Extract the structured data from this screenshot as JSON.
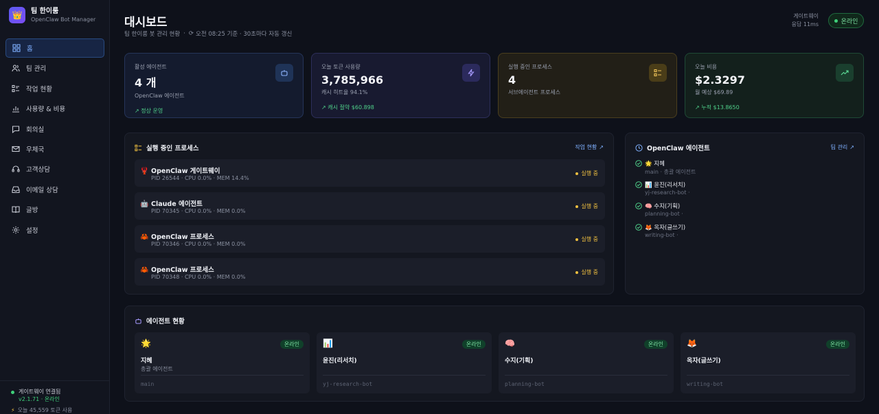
{
  "brand": {
    "name": "팀 한이룸",
    "subtitle": "OpenClaw Bot Manager",
    "logo_icon": "crown-icon"
  },
  "nav": [
    {
      "label": "홈",
      "icon": "grid-icon",
      "active": true
    },
    {
      "label": "팀 관리",
      "icon": "users-icon"
    },
    {
      "label": "작업 현황",
      "icon": "list-icon"
    },
    {
      "label": "사용량 & 비용",
      "icon": "bar-chart-icon"
    },
    {
      "label": "회의실",
      "icon": "chat-icon"
    },
    {
      "label": "우체국",
      "icon": "mail-icon"
    },
    {
      "label": "고객상담",
      "icon": "headset-icon"
    },
    {
      "label": "이메일 상담",
      "icon": "inbox-icon"
    },
    {
      "label": "글방",
      "icon": "book-icon"
    },
    {
      "label": "설정",
      "icon": "gear-icon"
    }
  ],
  "sidebar_footer": {
    "gateway_connected": "게이트웨이 연결됨",
    "version_status": "v2.1.71 · 온라인",
    "tokens_today": "오늘 45,559 토큰 사용"
  },
  "header": {
    "title": "대시보드",
    "subtitle": "팀 한이룸 봇 관리 현황",
    "refresh": "오전 08:25 기준 · 30초마다 자동 갱신",
    "gateway_label": "게이트웨이",
    "gateway_latency": "응답 11ms",
    "online": "온라인"
  },
  "stats": [
    {
      "label": "활성 에이전트",
      "value": "4 개",
      "sub": "OpenClaw 에이전트",
      "foot": "↗ 정상 운영",
      "icon": "bot-icon"
    },
    {
      "label": "오늘 토큰 사용량",
      "value": "3,785,966",
      "sub": "캐시 히트율 94.1%",
      "foot": "↗ 캐시 절약 $60.898",
      "icon": "bolt-icon"
    },
    {
      "label": "실행 중인 프로세스",
      "value": "4",
      "sub": "서브에이전트 프로세스",
      "foot": "",
      "icon": "list-icon"
    },
    {
      "label": "오늘 비용",
      "value": "$2.3297",
      "sub": "월 예상 $69.89",
      "foot": "↗ 누적 $13.8650",
      "icon": "trend-up-icon"
    }
  ],
  "processes": {
    "title": "실행 중인 프로세스",
    "link": "작업 현황",
    "items": [
      {
        "emoji": "🦞",
        "name": "OpenClaw 게이트웨이",
        "meta": "PID 26544 · CPU 0.0% · MEM 14.4%",
        "status": "실행 중"
      },
      {
        "emoji": "🤖",
        "name": "Claude 에이전트",
        "meta": "PID 70345 · CPU 0.0% · MEM 0.0%",
        "status": "실행 중"
      },
      {
        "emoji": "🦀",
        "name": "OpenClaw 프로세스",
        "meta": "PID 70346 · CPU 0.0% · MEM 0.0%",
        "status": "실행 중"
      },
      {
        "emoji": "🦀",
        "name": "OpenClaw 프로세스",
        "meta": "PID 70348 · CPU 0.0% · MEM 0.0%",
        "status": "실행 중"
      }
    ]
  },
  "openclaw_agents": {
    "title": "OpenClaw 에이전트",
    "link": "팀 관리",
    "items": [
      {
        "name": "🌟 지혜",
        "desc": "main · 총괄 에이전트"
      },
      {
        "name": "📊 윤진(리서치)",
        "desc": "yj-research-bot ·"
      },
      {
        "name": "🧠 수지(기획)",
        "desc": "planning-bot ·"
      },
      {
        "name": "🦊 옥자(글쓰기)",
        "desc": "writing-bot ·"
      }
    ]
  },
  "agent_status": {
    "title": "에이전트 현황",
    "cards": [
      {
        "emoji": "🌟",
        "name": "지혜",
        "role": "총괄 에이전트",
        "id": "main",
        "badge": "온라인"
      },
      {
        "emoji": "📊",
        "name": "윤진(리서치)",
        "role": "",
        "id": "yj-research-bot",
        "badge": "온라인"
      },
      {
        "emoji": "🧠",
        "name": "수지(기획)",
        "role": "",
        "id": "planning-bot",
        "badge": "온라인"
      },
      {
        "emoji": "🦊",
        "name": "옥자(글쓰기)",
        "role": "",
        "id": "writing-bot",
        "badge": "온라인"
      }
    ]
  },
  "colors": {
    "accent": "#7fb0ff",
    "online": "#3fd07a",
    "running": "#f0c040",
    "background": "#0e111a"
  }
}
